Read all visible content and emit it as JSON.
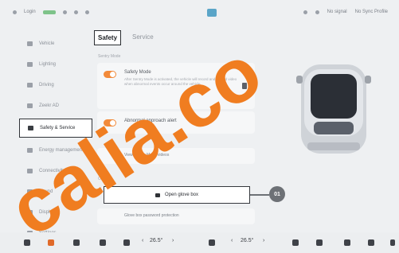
{
  "status": {
    "left_items": [
      "Login",
      "",
      "",
      ""
    ],
    "right_items": [
      "",
      "",
      "No signal",
      "No Sync Profile"
    ]
  },
  "sidebar": {
    "items": [
      {
        "label": "Vehicle",
        "icon": "car-icon"
      },
      {
        "label": "Lighting",
        "icon": "light-icon"
      },
      {
        "label": "Driving",
        "icon": "steering-icon"
      },
      {
        "label": "Zeekr AD",
        "icon": "assist-icon"
      },
      {
        "label": "Safety & Service",
        "icon": "shield-icon",
        "active": true
      },
      {
        "label": "Energy management",
        "icon": "battery-icon"
      },
      {
        "label": "Connectivity",
        "icon": "link-icon"
      },
      {
        "label": "Sound",
        "icon": "sound-icon"
      },
      {
        "label": "Display",
        "icon": "display-icon"
      },
      {
        "label": "Settings",
        "icon": "gear-icon"
      }
    ]
  },
  "tabs": [
    {
      "label": "Safety",
      "active": true
    },
    {
      "label": "Service",
      "active": false
    }
  ],
  "content": {
    "section_title": "Sentry Mode",
    "safety_mode_title": "Safety Mode",
    "safety_mode_desc": "After Sentry Mode is activated, the vehicle will record and upload video when abnormal events occur around the vehicle",
    "alert_title": "Abnormal approach alert",
    "restore_link": "View Sentry Mode videos",
    "other_label": "Other",
    "glove_box_label": "Open glove box",
    "password_label": "Glove box password protection",
    "callout": "01"
  },
  "taskbar": {
    "temp_left": "26.5°",
    "temp_right": "26.5°"
  },
  "watermark": {
    "text": "calia.co",
    "color": "#f07d20"
  }
}
